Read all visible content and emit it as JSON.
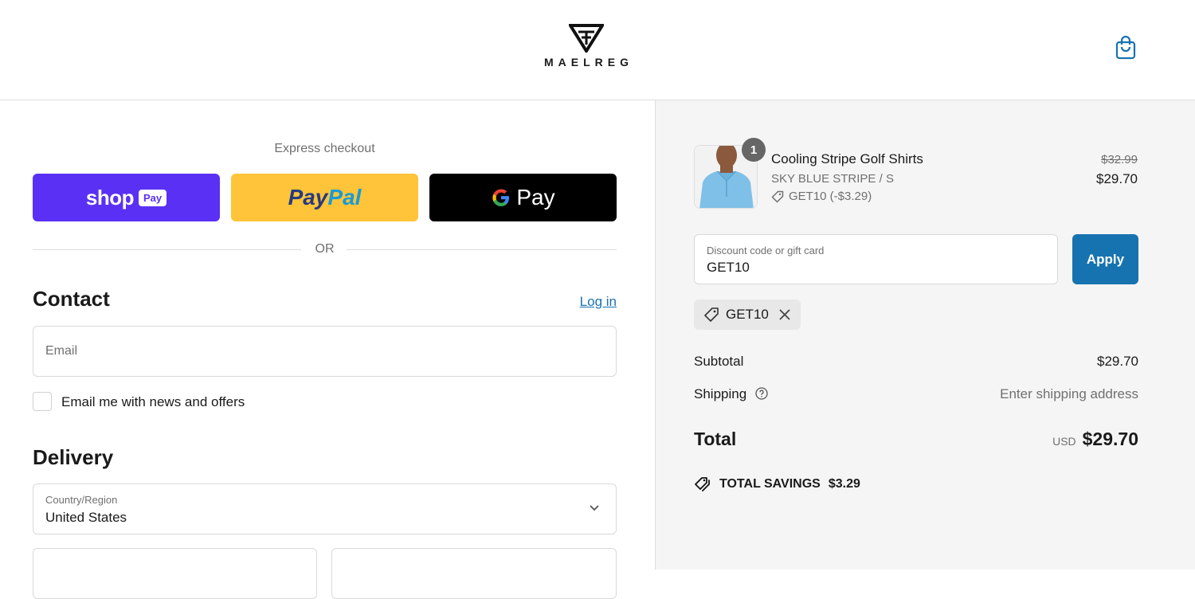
{
  "brand": {
    "name": "MAELREG"
  },
  "express": {
    "label": "Express checkout",
    "shop_pay": {
      "shop": "shop",
      "pay": "Pay"
    },
    "paypal": {
      "pay": "Pay",
      "pal": "Pal"
    },
    "gpay": {
      "g": "G",
      "pay": "Pay"
    },
    "or": "OR"
  },
  "contact": {
    "heading": "Contact",
    "login": "Log in",
    "email_placeholder": "Email",
    "newsletter_label": "Email me with news and offers"
  },
  "delivery": {
    "heading": "Delivery",
    "country_label": "Country/Region",
    "country_value": "United States"
  },
  "order": {
    "item": {
      "quantity": "1",
      "name": "Cooling Stripe Golf Shirts",
      "variant": "SKY BLUE STRIPE / S",
      "discount": "GET10 (-$3.29)",
      "original_price": "$32.99",
      "price": "$29.70"
    },
    "discount_field": {
      "label": "Discount code or gift card",
      "value": "GET10"
    },
    "apply": "Apply",
    "applied_code": "GET10",
    "subtotal": {
      "label": "Subtotal",
      "value": "$29.70"
    },
    "shipping": {
      "label": "Shipping",
      "value": "Enter shipping address"
    },
    "total": {
      "label": "Total",
      "currency": "USD",
      "value": "$29.70"
    },
    "savings": {
      "label": "TOTAL SAVINGS",
      "value": "$3.29"
    }
  },
  "colors": {
    "accent": "#1773b0",
    "shop_pay": "#5a31f4",
    "paypal": "#ffc439",
    "gpay": "#000000"
  }
}
